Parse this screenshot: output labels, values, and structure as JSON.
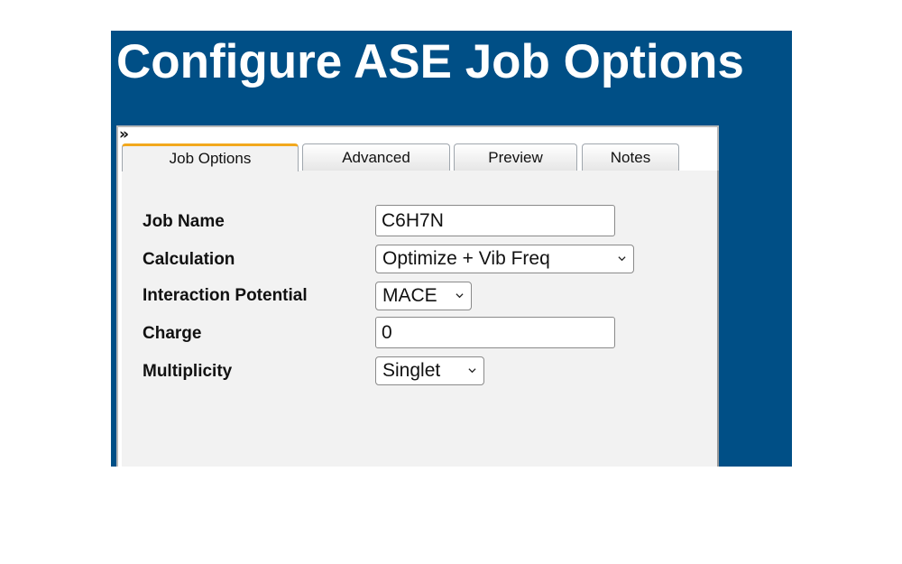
{
  "window": {
    "title": "Configure ASE Job Options"
  },
  "panel": {
    "expand_icon": "double-chevron-right-icon",
    "expand_glyph": "»"
  },
  "tabs": [
    {
      "label": "Job Options",
      "active": true
    },
    {
      "label": "Advanced",
      "active": false
    },
    {
      "label": "Preview",
      "active": false
    },
    {
      "label": "Notes",
      "active": false
    }
  ],
  "form": {
    "job_name": {
      "label": "Job Name",
      "value": "C6H7N"
    },
    "calculation": {
      "label": "Calculation",
      "value": "Optimize + Vib Freq"
    },
    "interaction_potential": {
      "label": "Interaction Potential",
      "value": "MACE"
    },
    "charge": {
      "label": "Charge",
      "value": "0"
    },
    "multiplicity": {
      "label": "Multiplicity",
      "value": "Singlet"
    }
  },
  "colors": {
    "header_background": "#004f86",
    "active_tab_accent": "#f2a81d",
    "content_background": "#f2f2f2"
  }
}
